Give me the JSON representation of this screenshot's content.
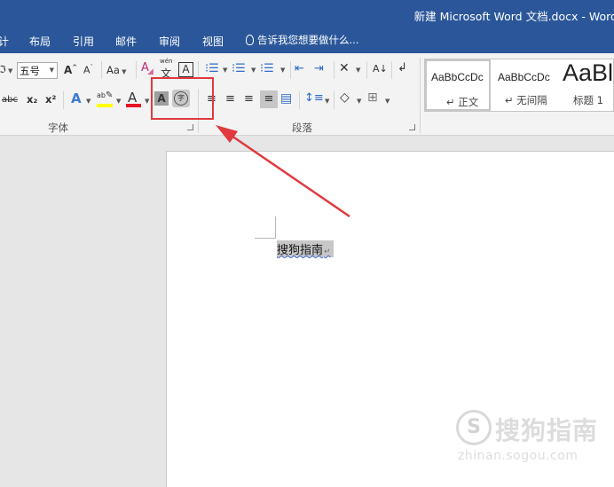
{
  "titlebar": {
    "title": "新建 Microsoft Word 文档.docx - Word"
  },
  "menu": {
    "tabs": [
      "计",
      "布局",
      "引用",
      "邮件",
      "审阅",
      "视图"
    ],
    "tell_me": "告诉我您想要做什么..."
  },
  "font_group": {
    "font_name_partial": "ℑ",
    "font_size": "五号",
    "grow_font": "A",
    "shrink_font": "A",
    "change_case": "Aa",
    "phonetic_guide": "wén",
    "character_border": "A",
    "strikethrough": "abc",
    "subscript": "x₂",
    "superscript": "x²",
    "text_effects": "A",
    "highlight": "ab",
    "font_color": "A",
    "character_shading": "A",
    "enclose_characters": "字",
    "label": "字体"
  },
  "paragraph_group": {
    "label": "段落",
    "sort_label": "A↓"
  },
  "styles": {
    "items": [
      {
        "sample": "AaBbCcDc",
        "name": "正文"
      },
      {
        "sample": "AaBbCcDc",
        "name": "无间隔"
      },
      {
        "sample": "AaBl",
        "name": "标题 1"
      }
    ]
  },
  "document": {
    "selected_text": "搜狗指南",
    "paragraph_mark": "↵"
  },
  "watermark": {
    "logo": "S",
    "text": "搜狗指南",
    "url": "zhinan.sogou.com"
  },
  "colors": {
    "title_bar": "#2b579a",
    "highlight_box": "#e0393e",
    "highlight_yellow": "#ffff00",
    "font_color_red": "#e81123"
  }
}
